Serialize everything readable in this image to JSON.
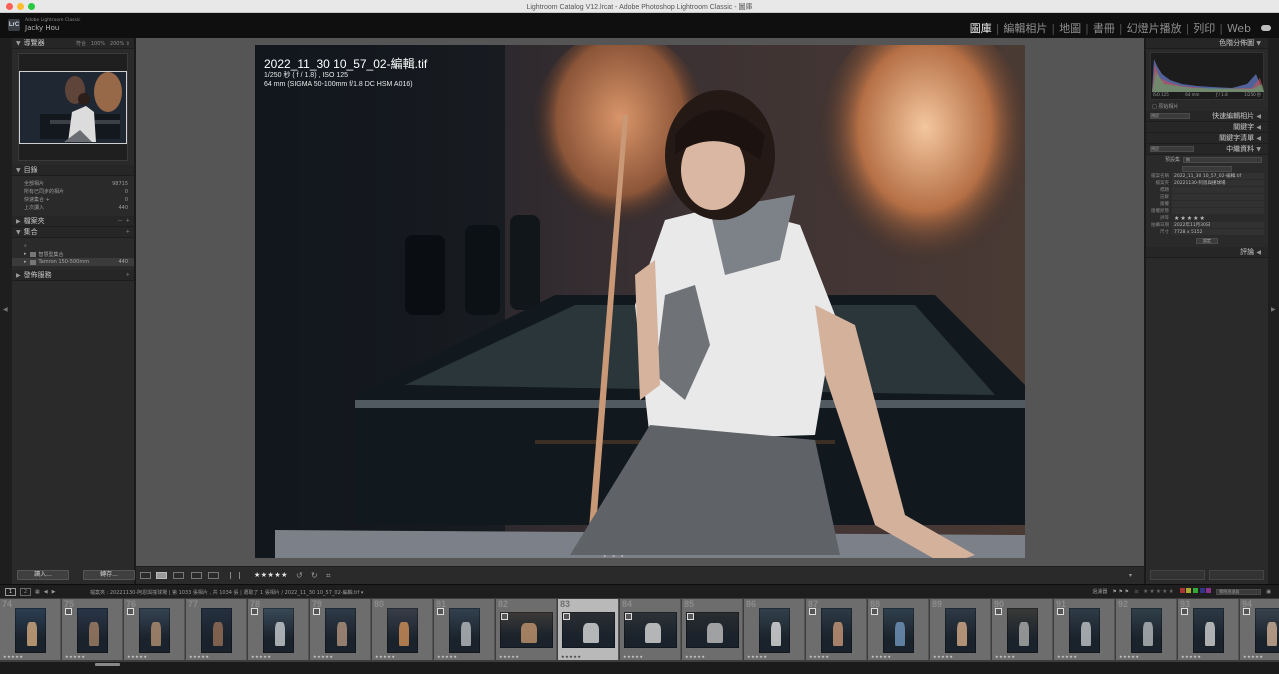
{
  "window": {
    "title": "Lightroom Catalog V12.lrcat - Adobe Photoshop Lightroom Classic - 圖庫"
  },
  "identity": {
    "app_name": "Adobe Lightroom Classic",
    "user": "Jacky Hou",
    "logo_text": "LrC"
  },
  "modules": [
    "圖庫",
    "編輯相片",
    "地圖",
    "書冊",
    "幻燈片播放",
    "列印",
    "Web"
  ],
  "active_module": "圖庫",
  "left_panel": {
    "navigator": {
      "title": "導覽器",
      "zoom_options": [
        "符合",
        "100%",
        "200%"
      ]
    },
    "catalog": {
      "title": "目錄",
      "items": [
        {
          "label": "全部相片",
          "count": "98715"
        },
        {
          "label": "所有已同步的相片",
          "count": "0"
        },
        {
          "label": "快速集合 +",
          "count": "0"
        },
        {
          "label": "上次讀入",
          "count": "440"
        }
      ]
    },
    "folders": {
      "title": "檔案夾"
    },
    "collections": {
      "title": "集合",
      "items": [
        {
          "label": "智慧型集合",
          "count": ""
        },
        {
          "label": "Tamron 150-500mm",
          "count": "440"
        }
      ]
    },
    "publish": {
      "title": "發佈服務"
    },
    "buttons": {
      "import": "讀入...",
      "export": "轉存..."
    }
  },
  "loupe": {
    "filename": "2022_11_30 10_57_02-編輯.tif",
    "exposure_line": "1/250 秒 ( f / 1.8) , ISO 125",
    "lens_line": "64 mm (SIGMA 50-100mm f/1.8 DC HSM A016)"
  },
  "toolbar": {
    "stars": "★★★★★"
  },
  "right_panel": {
    "histogram": {
      "title": "色階分佈圖",
      "iso": "ISO 125",
      "focal": "64 mm",
      "aperture": "ƒ / 1.8",
      "shutter": "1/250 秒",
      "original_label": "□ 原始相片"
    },
    "quick_develop": {
      "title": "快速編輯相片",
      "preset": "預設"
    },
    "keywording": {
      "title": "關鍵字"
    },
    "keyword_list": {
      "title": "關鍵字清單"
    },
    "metadata": {
      "title": "中繼資料",
      "preset_label": "預設集",
      "preset_value": "無",
      "mode": "預設",
      "fields": [
        {
          "key": "檔案名稱",
          "value": "2022_11_30 10_57_02-編輯.tif"
        },
        {
          "key": "檔案夾",
          "value": "20221130-阿恩與撞球場"
        },
        {
          "key": "標題",
          "value": ""
        },
        {
          "key": "註解",
          "value": ""
        },
        {
          "key": "版權",
          "value": ""
        },
        {
          "key": "版權狀態",
          "value": ""
        },
        {
          "key": "評等",
          "value": "★★★★★"
        },
        {
          "key": "拍攝日期",
          "value": "2022年11月30日"
        },
        {
          "key": "尺寸",
          "value": "7728 x 5152"
        }
      ],
      "edit_button": "設定"
    },
    "comments": {
      "title": "評論"
    }
  },
  "filmstrip": {
    "path": "檔案夾 : 20221130-阿恩與撞球場  |  第 1033 張相片 , 共 1034 張  | 選取了 1 張相片  / 2022_11_30 10_57_02-編輯.tif ▾",
    "filter_label": "過濾器",
    "filter_mode": "關閉過濾器",
    "frame_numbers": [
      "74",
      "75",
      "76",
      "77",
      "78",
      "79",
      "80",
      "81",
      "82",
      "83",
      "84",
      "85",
      "86",
      "87",
      "88",
      "89",
      "90",
      "91",
      "92",
      "93",
      "94"
    ],
    "selected_index": 9
  },
  "colors": {
    "panel": "#2a2a2a",
    "center": "#555555",
    "strip": "#3d3d3d",
    "selected_cell": "#b9b9b9"
  }
}
